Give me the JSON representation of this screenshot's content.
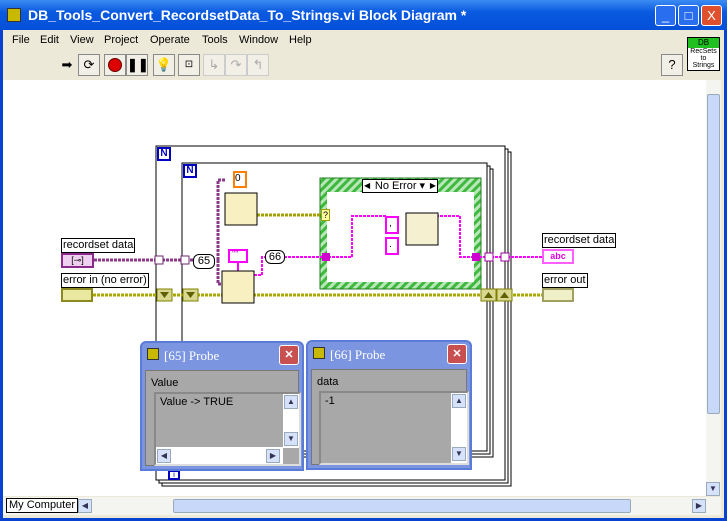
{
  "window": {
    "title": "DB_Tools_Convert_RecordsetData_To_Strings.vi Block Diagram *",
    "minimize": "_",
    "maximize": "□",
    "close": "X"
  },
  "menu": [
    "File",
    "Edit",
    "View",
    "Project",
    "Operate",
    "Tools",
    "Window",
    "Help"
  ],
  "toolbar": {
    "icons": [
      "run-arrow-icon",
      "run-continuously-icon",
      "abort-icon",
      "pause-icon",
      "highlight-execution-icon",
      "retain-wire-values-icon",
      "step-into-icon",
      "step-over-icon",
      "step-out-icon"
    ],
    "help": "?"
  },
  "vi_icon": {
    "top": "DB",
    "lines": [
      "RecSets",
      "to",
      "Strings"
    ]
  },
  "diagram": {
    "recordset_in": "recordset data",
    "error_in": "error in (no error)",
    "recordset_out": "recordset data",
    "error_out": "error out",
    "const_zero": "0",
    "probe65": "65",
    "probe66": "66",
    "case_selector": "No Error",
    "loop_n": "N",
    "loop_i": "i",
    "selector_q": "?",
    "comma": ",",
    "period": ".",
    "string_const": "\"\"",
    "abc": "abc"
  },
  "probes": [
    {
      "title": "[65] Probe",
      "label": "Value",
      "value": "Value -> TRUE"
    },
    {
      "title": "[66] Probe",
      "label": "data",
      "value": "-1"
    }
  ],
  "status": {
    "context": "My Computer"
  },
  "colors": {
    "titlebar": "#0a5ae0",
    "string_wire": "#ff00ff",
    "error_wire": "#b8b800",
    "case_border": "#44c044",
    "loop_label": "#0000c0"
  }
}
